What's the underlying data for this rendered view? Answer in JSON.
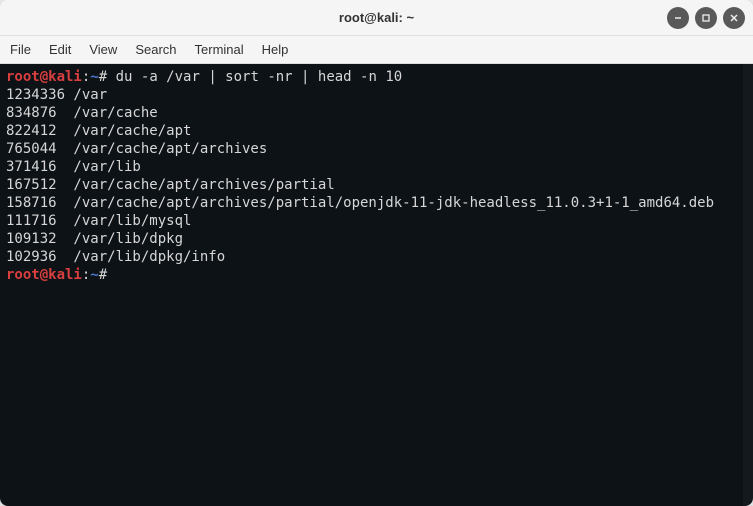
{
  "window": {
    "title": "root@kali: ~"
  },
  "menu": {
    "items": [
      "File",
      "Edit",
      "View",
      "Search",
      "Terminal",
      "Help"
    ]
  },
  "prompt": {
    "user_host": "root@kali",
    "colon": ":",
    "path": "~",
    "hash": "#"
  },
  "command": "du -a /var | sort -nr | head -n 10",
  "output_lines": [
    "1234336 /var",
    "834876  /var/cache",
    "822412  /var/cache/apt",
    "765044  /var/cache/apt/archives",
    "371416  /var/lib",
    "167512  /var/cache/apt/archives/partial",
    "158716  /var/cache/apt/archives/partial/openjdk-11-jdk-headless_11.0.3+1-1_amd64.deb",
    "111716  /var/lib/mysql",
    "109132  /var/lib/dpkg",
    "102936  /var/lib/dpkg/info"
  ]
}
